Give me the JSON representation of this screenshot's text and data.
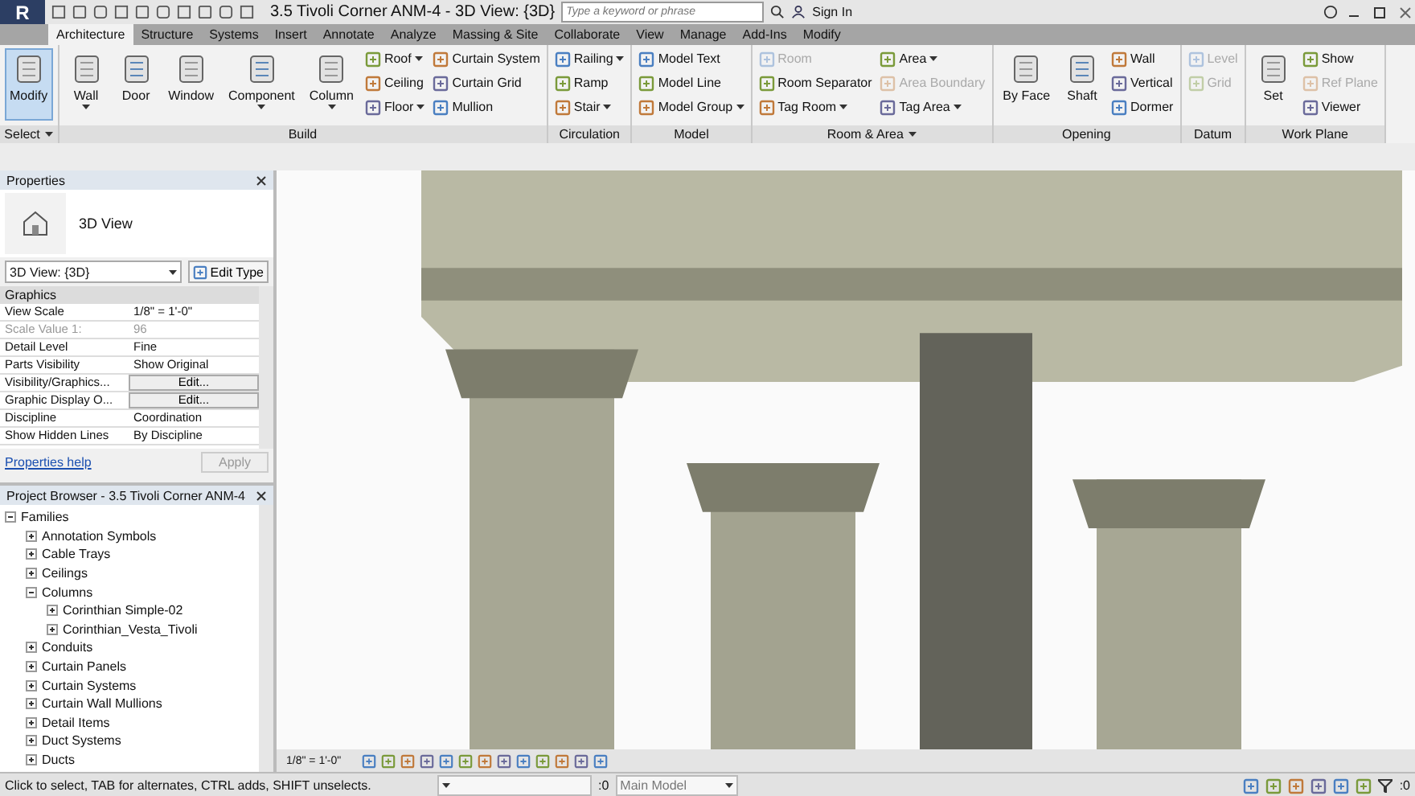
{
  "app_menu": {
    "logo": "R"
  },
  "title": "3.5 Tivoli Corner ANM-4 - 3D View: {3D}",
  "search": {
    "placeholder": "Type a keyword or phrase"
  },
  "sign_in": "Sign In",
  "tabs": [
    {
      "label": "Architecture",
      "selected": true
    },
    {
      "label": "Structure",
      "selected": false
    },
    {
      "label": "Systems",
      "selected": false
    },
    {
      "label": "Insert",
      "selected": false
    },
    {
      "label": "Annotate",
      "selected": false
    },
    {
      "label": "Analyze",
      "selected": false
    },
    {
      "label": "Massing & Site",
      "selected": false
    },
    {
      "label": "Collaborate",
      "selected": false
    },
    {
      "label": "View",
      "selected": false
    },
    {
      "label": "Manage",
      "selected": false
    },
    {
      "label": "Add-Ins",
      "selected": false
    },
    {
      "label": "Modify",
      "selected": false
    }
  ],
  "ribbon_panels": [
    {
      "label": "Select",
      "has_menu": true,
      "tools": [
        {
          "kind": "large",
          "label": "Modify",
          "dropdown": false,
          "selected": true
        }
      ]
    },
    {
      "label": "Build",
      "has_menu": false,
      "tools": [
        {
          "kind": "large",
          "label": "Wall",
          "dropdown": true,
          "selected": false
        },
        {
          "kind": "large",
          "label": "Door",
          "dropdown": false,
          "selected": false
        },
        {
          "kind": "large",
          "label": "Window",
          "dropdown": false,
          "selected": false
        },
        {
          "kind": "large",
          "label": "Component",
          "dropdown": true,
          "selected": false
        },
        {
          "kind": "large",
          "label": "Column",
          "dropdown": true,
          "selected": false
        },
        {
          "kind": "stack",
          "items": [
            {
              "label": "Roof",
              "dropdown": true,
              "disabled": false
            },
            {
              "label": "Ceiling",
              "dropdown": false,
              "disabled": false
            },
            {
              "label": "Floor",
              "dropdown": true,
              "disabled": false
            }
          ]
        },
        {
          "kind": "stack",
          "items": [
            {
              "label": "Curtain System",
              "dropdown": false,
              "disabled": false
            },
            {
              "label": "Curtain Grid",
              "dropdown": false,
              "disabled": false
            },
            {
              "label": "Mullion",
              "dropdown": false,
              "disabled": false
            }
          ]
        }
      ]
    },
    {
      "label": "Circulation",
      "has_menu": false,
      "tools": [
        {
          "kind": "stack",
          "items": [
            {
              "label": "Railing",
              "dropdown": true,
              "disabled": false
            },
            {
              "label": "Ramp",
              "dropdown": false,
              "disabled": false
            },
            {
              "label": "Stair",
              "dropdown": true,
              "disabled": false
            }
          ]
        }
      ]
    },
    {
      "label": "Model",
      "has_menu": false,
      "tools": [
        {
          "kind": "stack",
          "items": [
            {
              "label": "Model Text",
              "dropdown": false,
              "disabled": false
            },
            {
              "label": "Model Line",
              "dropdown": false,
              "disabled": false
            },
            {
              "label": "Model Group",
              "dropdown": true,
              "disabled": false
            }
          ]
        }
      ]
    },
    {
      "label": "Room & Area",
      "has_menu": true,
      "tools": [
        {
          "kind": "stack",
          "items": [
            {
              "label": "Room",
              "dropdown": false,
              "disabled": true
            },
            {
              "label": "Room Separator",
              "dropdown": false,
              "disabled": false
            },
            {
              "label": "Tag Room",
              "dropdown": true,
              "disabled": false
            }
          ]
        },
        {
          "kind": "stack",
          "items": [
            {
              "label": "Area",
              "dropdown": true,
              "disabled": false
            },
            {
              "label": "Area Boundary",
              "dropdown": false,
              "disabled": true
            },
            {
              "label": "Tag Area",
              "dropdown": true,
              "disabled": false
            }
          ]
        }
      ]
    },
    {
      "label": "Opening",
      "has_menu": false,
      "tools": [
        {
          "kind": "large",
          "label": "By Face",
          "dropdown": false,
          "selected": false
        },
        {
          "kind": "large",
          "label": "Shaft",
          "dropdown": false,
          "selected": false
        },
        {
          "kind": "stack",
          "items": [
            {
              "label": "Wall",
              "dropdown": false,
              "disabled": false
            },
            {
              "label": "Vertical",
              "dropdown": false,
              "disabled": false
            },
            {
              "label": "Dormer",
              "dropdown": false,
              "disabled": false
            }
          ]
        }
      ]
    },
    {
      "label": "Datum",
      "has_menu": false,
      "tools": [
        {
          "kind": "stack",
          "items": [
            {
              "label": "Level",
              "dropdown": false,
              "disabled": true
            },
            {
              "label": "Grid",
              "dropdown": false,
              "disabled": true
            }
          ]
        }
      ]
    },
    {
      "label": "Work Plane",
      "has_menu": false,
      "tools": [
        {
          "kind": "large",
          "label": "Set",
          "dropdown": false,
          "selected": false
        },
        {
          "kind": "stack",
          "items": [
            {
              "label": "Show",
              "dropdown": false,
              "disabled": false
            },
            {
              "label": "Ref Plane",
              "dropdown": false,
              "disabled": true
            },
            {
              "label": "Viewer",
              "dropdown": false,
              "disabled": false
            }
          ]
        }
      ]
    }
  ],
  "properties": {
    "title": "Properties",
    "type_name": "3D View",
    "view_selector": "3D View: {3D}",
    "edit_type": "Edit Type",
    "group": "Graphics",
    "rows": [
      {
        "kind": "text",
        "name": "View Scale",
        "value": "1/8\" = 1'-0\"",
        "disabled": false
      },
      {
        "kind": "text",
        "name": "Scale Value    1:",
        "value": "96",
        "disabled": true
      },
      {
        "kind": "text",
        "name": "Detail Level",
        "value": "Fine",
        "disabled": false
      },
      {
        "kind": "text",
        "name": "Parts Visibility",
        "value": "Show Original",
        "disabled": false
      },
      {
        "kind": "button",
        "name": "Visibility/Graphics...",
        "value": "Edit...",
        "disabled": false
      },
      {
        "kind": "button",
        "name": "Graphic Display O...",
        "value": "Edit...",
        "disabled": false
      },
      {
        "kind": "text",
        "name": "Discipline",
        "value": "Coordination",
        "disabled": false
      },
      {
        "kind": "text",
        "name": "Show Hidden Lines",
        "value": "By Discipline",
        "disabled": false
      }
    ],
    "help": "Properties help",
    "apply": "Apply"
  },
  "project_browser": {
    "title": "Project Browser - 3.5 Tivoli Corner ANM-4",
    "tree": [
      {
        "label": "Families",
        "expanded": true,
        "children": [
          {
            "label": "Annotation Symbols",
            "expanded": false
          },
          {
            "label": "Cable Trays",
            "expanded": false
          },
          {
            "label": "Ceilings",
            "expanded": false
          },
          {
            "label": "Columns",
            "expanded": true,
            "children": [
              {
                "label": "Corinthian Simple-02",
                "expanded": false
              },
              {
                "label": "Corinthian_Vesta_Tivoli",
                "expanded": false
              }
            ]
          },
          {
            "label": "Conduits",
            "expanded": false
          },
          {
            "label": "Curtain Panels",
            "expanded": false
          },
          {
            "label": "Curtain Systems",
            "expanded": false
          },
          {
            "label": "Curtain Wall Mullions",
            "expanded": false
          },
          {
            "label": "Detail Items",
            "expanded": false
          },
          {
            "label": "Duct Systems",
            "expanded": false
          },
          {
            "label": "Ducts",
            "expanded": false
          }
        ]
      }
    ]
  },
  "view_bar": {
    "scale": "1/8\" = 1'-0\""
  },
  "status_bar": {
    "message": "Click to select, TAB for alternates, CTRL adds, SHIFT unselects.",
    "count_1": ":0",
    "workset": "Main Model",
    "count_2": ":0"
  }
}
